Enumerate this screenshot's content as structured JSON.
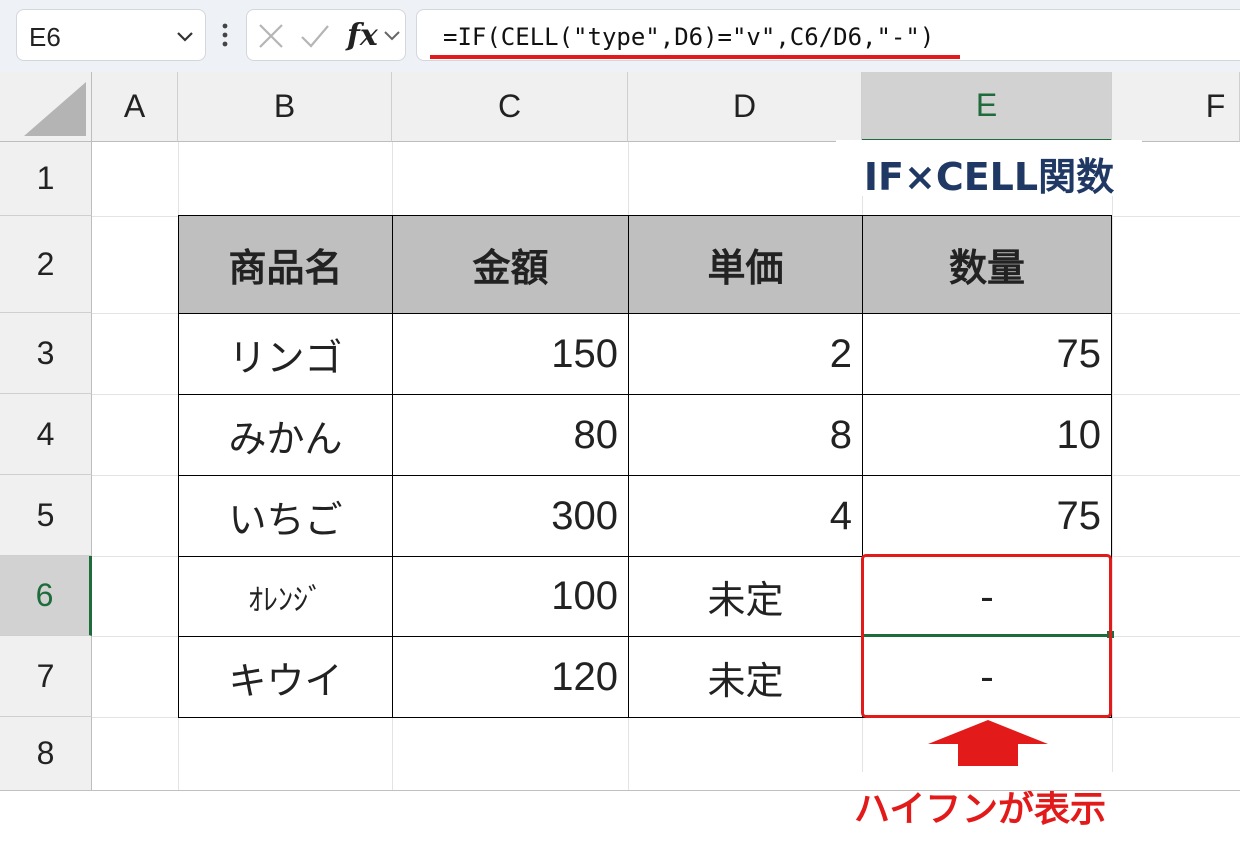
{
  "formula_bar": {
    "name_box": "E6",
    "fx_label": "fx",
    "formula": "=IF(CELL(\"type\",D6)=\"v\",C6/D6,\"-\")"
  },
  "columns": [
    "A",
    "B",
    "C",
    "D",
    "E",
    "F"
  ],
  "rows": [
    "1",
    "2",
    "3",
    "4",
    "5",
    "6",
    "7",
    "8"
  ],
  "selected": {
    "column": "E",
    "row": "6"
  },
  "sheet": {
    "title": "IF×CELL関数",
    "headers": [
      "商品名",
      "金額",
      "単価",
      "数量"
    ],
    "data_rows": [
      {
        "name": "リンゴ",
        "amount": "150",
        "unit_price": "2",
        "qty": "75"
      },
      {
        "name": "みかん",
        "amount": "80",
        "unit_price": "8",
        "qty": "10"
      },
      {
        "name": "いちご",
        "amount": "300",
        "unit_price": "4",
        "qty": "75"
      },
      {
        "name": "ｵﾚﾝｼﾞ",
        "amount": "100",
        "unit_price": "未定",
        "qty": "-"
      },
      {
        "name": "キウイ",
        "amount": "120",
        "unit_price": "未定",
        "qty": "-"
      }
    ]
  },
  "annotation": {
    "callout": "ハイフンが表示",
    "accent_color": "#e21a1a",
    "title_color": "#1f3864",
    "selection_color": "#1e6b3b"
  },
  "icons": [
    "chevron-down-icon",
    "more-options-icon",
    "cancel-x-icon",
    "enter-check-icon",
    "expand-chevron-icon",
    "up-arrow-icon"
  ]
}
